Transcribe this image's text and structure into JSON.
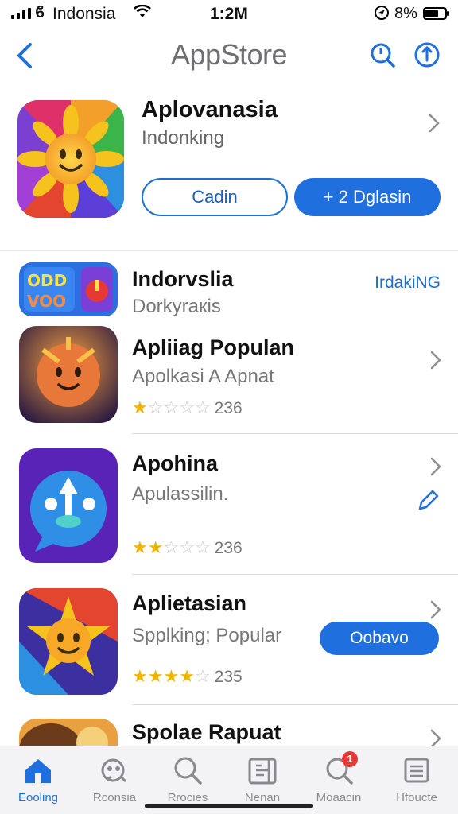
{
  "status_bar": {
    "carrier": "Indonsia",
    "time": "1:2M",
    "battery": "8%"
  },
  "nav": {
    "title": "AppStore"
  },
  "featured": {
    "name": "Aplovanasia",
    "subtitle": "Indonking",
    "secondary_button": "Cadin",
    "primary_button": "+ 2 Dglasin"
  },
  "list": [
    {
      "name": "Indorvslia",
      "subtitle": "Dorkyraкis",
      "tag": "IrdakiNG"
    },
    {
      "name": "Apliiag Populan",
      "subtitle": "Apolkasi A Apnat",
      "rating": 1,
      "rating_count": "236"
    },
    {
      "name": "Apohina",
      "subtitle": "Apulassilin.",
      "rating": 2,
      "rating_count": "236"
    },
    {
      "name": "Aplietasian",
      "subtitle": "Spplking; Popular",
      "rating": 4,
      "rating_count": "235",
      "button": "Oobavo"
    },
    {
      "name": "Spolae Rapuat"
    }
  ],
  "tabs": [
    {
      "label": "Eooling",
      "icon": "home-icon",
      "active": true
    },
    {
      "label": "Rconsia",
      "icon": "games-icon"
    },
    {
      "label": "Rrocies",
      "icon": "search-icon"
    },
    {
      "label": "Nenan",
      "icon": "arcade-icon"
    },
    {
      "label": "Moaacin",
      "icon": "updates-icon",
      "badge": "1"
    },
    {
      "label": "Hfoucte",
      "icon": "list-icon"
    }
  ],
  "colors": {
    "accent": "#1f6fde",
    "star": "#f0b400",
    "badge": "#e53935"
  }
}
